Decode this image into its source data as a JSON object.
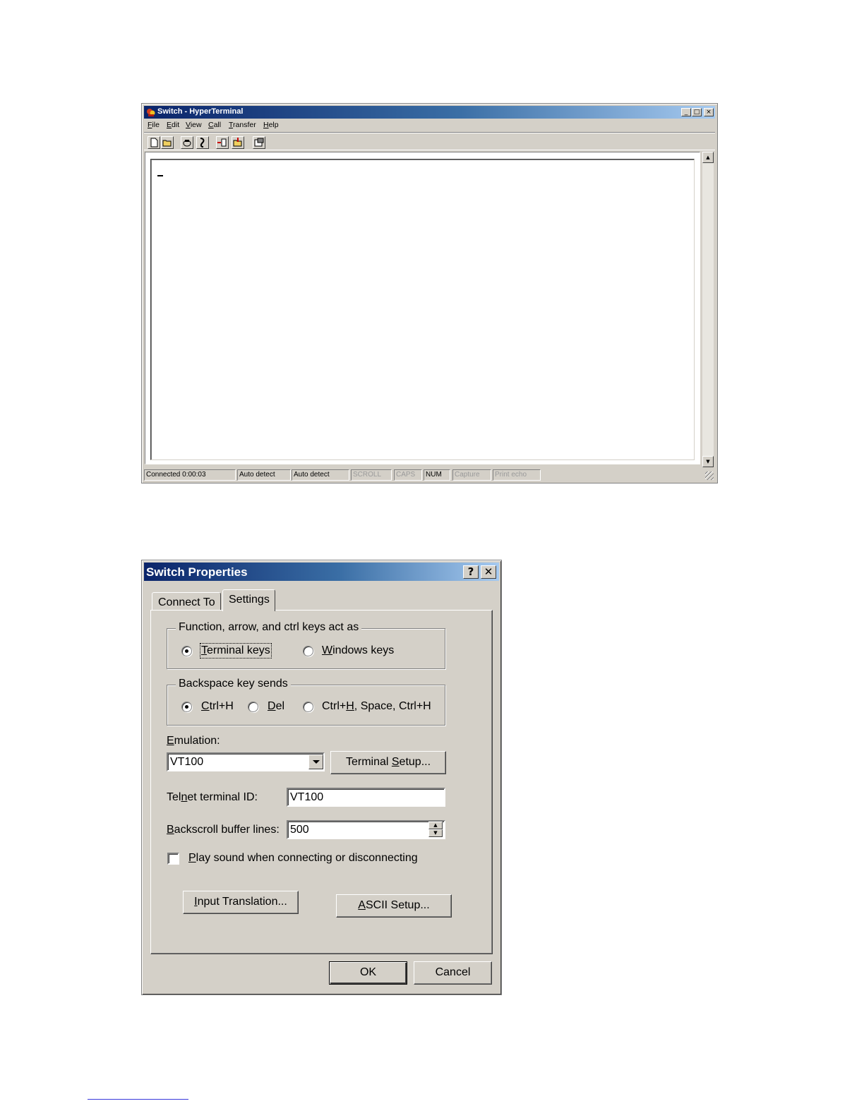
{
  "hyperterminal": {
    "title": "Switch - HyperTerminal",
    "caption_buttons": {
      "minimize": "_",
      "maximize": "□",
      "close": "×"
    },
    "menu": [
      {
        "mnemonic": "F",
        "rest": "ile"
      },
      {
        "mnemonic": "E",
        "rest": "dit"
      },
      {
        "mnemonic": "V",
        "rest": "iew"
      },
      {
        "mnemonic": "C",
        "rest": "all"
      },
      {
        "mnemonic": "T",
        "rest": "ransfer"
      },
      {
        "mnemonic": "H",
        "rest": "elp"
      }
    ],
    "toolbar_icons": [
      "new-document-icon",
      "open-folder-icon",
      "connect-phone-icon",
      "disconnect-phone-icon",
      "send-file-icon",
      "receive-file-icon",
      "properties-icon"
    ],
    "scrollbar": {
      "up": "▲",
      "down": "▼"
    },
    "status": {
      "connected": "Connected 0:00:03",
      "detect1": "Auto detect",
      "detect2": "Auto detect",
      "scroll": "SCROLL",
      "caps": "CAPS",
      "num": "NUM",
      "capture": "Capture",
      "print_echo": "Print echo"
    }
  },
  "dialog": {
    "title": "Switch Properties",
    "caption_buttons": {
      "help": "?",
      "close": "✕"
    },
    "tabs": [
      {
        "label": "Connect To"
      },
      {
        "label": "Settings"
      }
    ],
    "active_tab": "Settings",
    "function_keys": {
      "legend": "Function, arrow, and ctrl keys act as",
      "terminal": {
        "mnemonic": "T",
        "rest": "erminal keys",
        "selected": true
      },
      "windows": {
        "mnemonic": "W",
        "rest": "indows keys",
        "selected": false
      }
    },
    "backspace": {
      "legend": "Backspace key sends",
      "ctrl_h": {
        "mnemonic": "C",
        "rest": "trl+H",
        "selected": true
      },
      "del": {
        "mnemonic": "D",
        "rest": "el",
        "selected": false
      },
      "ctrl_h_space": {
        "pre": "Ctrl+",
        "mnemonic": "H",
        "rest": ", Space, Ctrl+H",
        "selected": false
      }
    },
    "emulation": {
      "label_mnemonic": "E",
      "label_rest": "mulation:",
      "value": "VT100",
      "setup_pre": "Terminal ",
      "setup_mnemonic": "S",
      "setup_rest": "etup..."
    },
    "telnet": {
      "label_pre": "Tel",
      "label_mnemonic": "n",
      "label_rest": "et terminal ID:",
      "value": "VT100"
    },
    "backscroll": {
      "label_mnemonic": "B",
      "label_rest": "ackscroll buffer lines:",
      "value": "500",
      "spin_up": "▲",
      "spin_down": "▼"
    },
    "play_sound": {
      "mnemonic": "P",
      "rest": "lay sound when connecting or disconnecting",
      "checked": false
    },
    "input_translation": {
      "mnemonic": "I",
      "rest": "nput Translation..."
    },
    "ascii_setup": {
      "mnemonic": "A",
      "rest": "SCII Setup..."
    },
    "ok": "OK",
    "cancel": "Cancel"
  }
}
